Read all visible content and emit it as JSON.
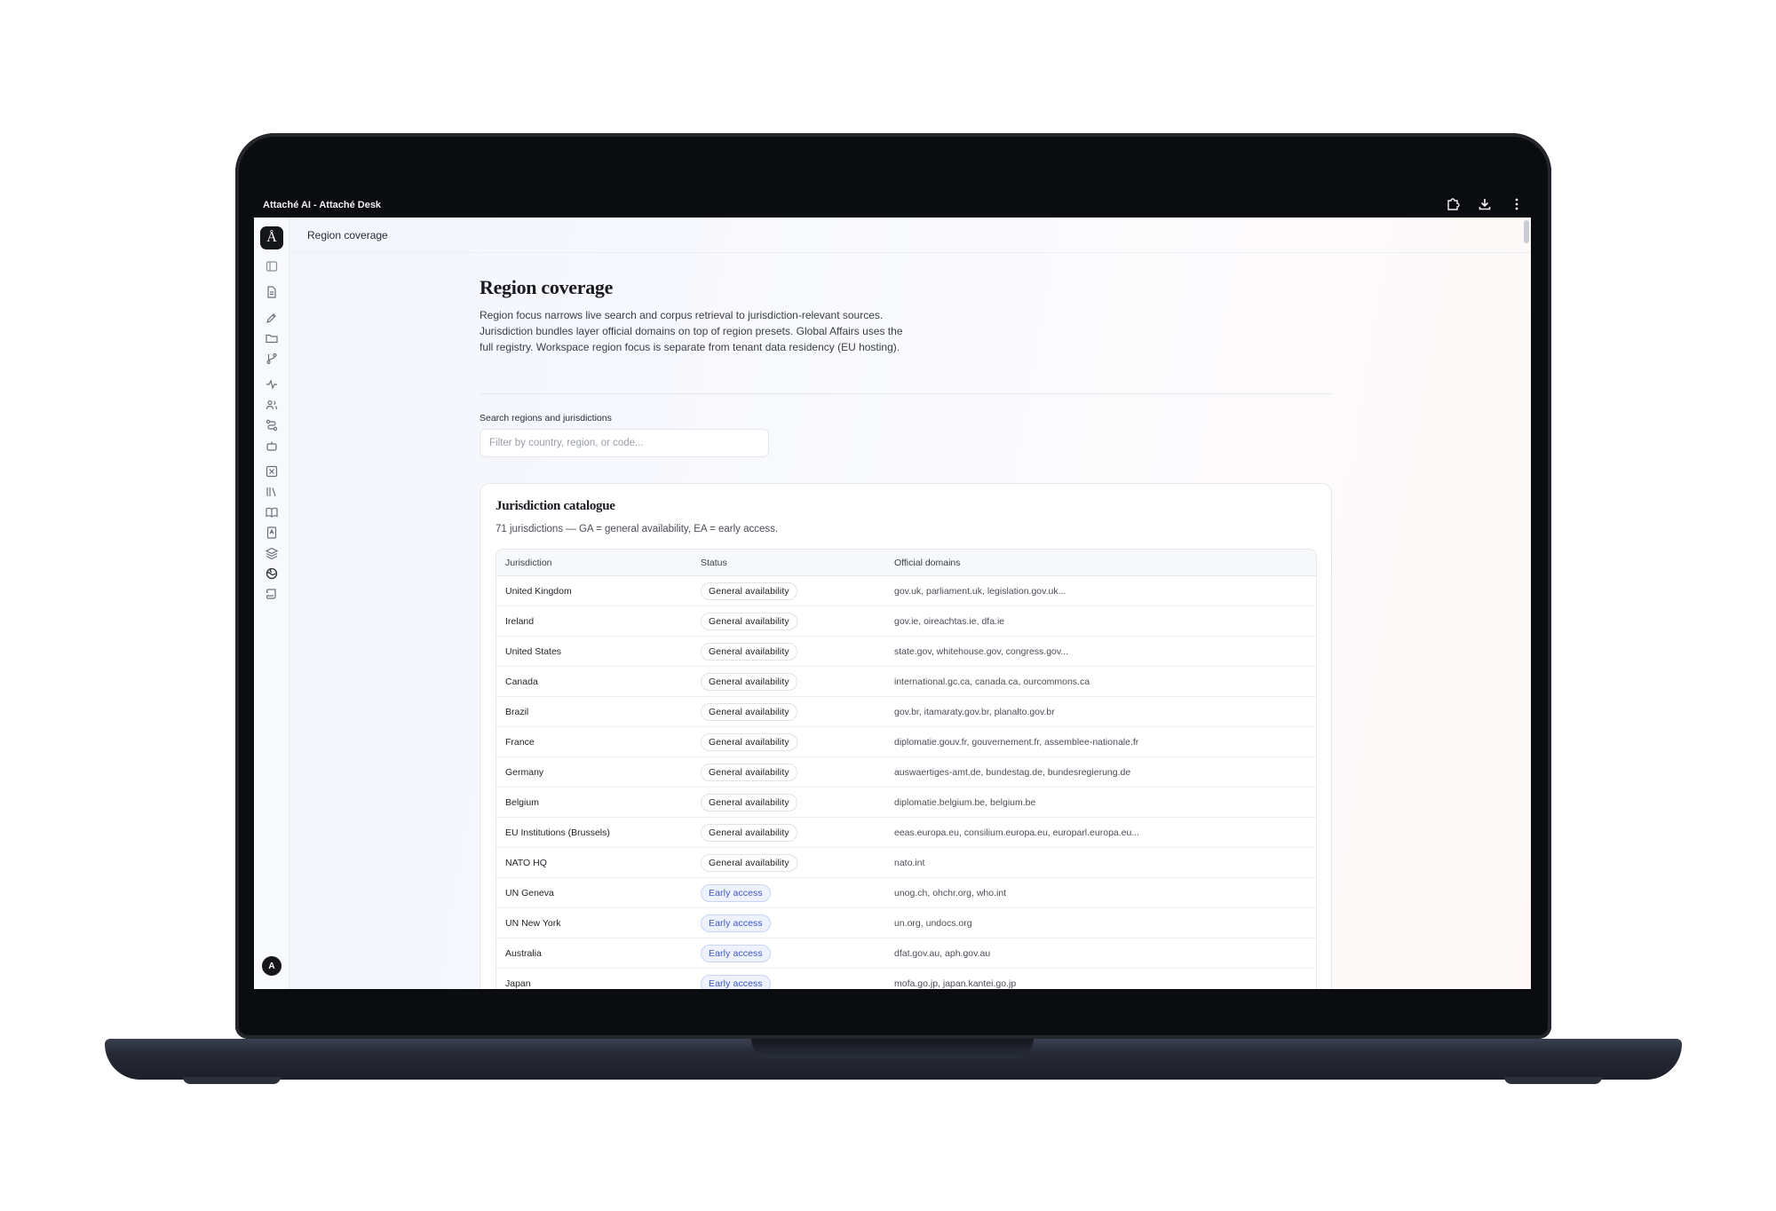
{
  "window": {
    "title": "Attaché AI - Attaché Desk",
    "actions": [
      "extension-icon",
      "download-icon",
      "more-vertical-icon"
    ]
  },
  "rail": {
    "logo": "Å",
    "avatar": "A",
    "icons": [
      "sidebar-toggle-icon",
      "document-icon",
      "pen-icon",
      "folder-icon",
      "git-branch-icon",
      "activity-icon",
      "users-icon",
      "route-icon",
      "bot-icon",
      "square-x-icon",
      "library-icon",
      "book-open-icon",
      "file-text-icon",
      "layers-icon",
      "globe-icon",
      "scroll-icon"
    ]
  },
  "topbar": {
    "breadcrumb": "Region coverage"
  },
  "page": {
    "title": "Region coverage",
    "description": "Region focus narrows live search and corpus retrieval to jurisdiction-relevant sources. Jurisdiction bundles layer official domains on top of region presets. Global Affairs uses the full registry. Workspace region focus is separate from tenant data residency (EU hosting)."
  },
  "search": {
    "label": "Search regions and jurisdictions",
    "placeholder": "Filter by country, region, or code..."
  },
  "catalogue": {
    "title": "Jurisdiction catalogue",
    "subtitle": "71 jurisdictions — GA = general availability, EA = early access.",
    "columns": [
      "Jurisdiction",
      "Status",
      "Official domains"
    ],
    "rows": [
      {
        "jurisdiction": "United Kingdom",
        "status": "General availability",
        "kind": "ga",
        "domains": "gov.uk, parliament.uk, legislation.gov.uk..."
      },
      {
        "jurisdiction": "Ireland",
        "status": "General availability",
        "kind": "ga",
        "domains": "gov.ie, oireachtas.ie, dfa.ie"
      },
      {
        "jurisdiction": "United States",
        "status": "General availability",
        "kind": "ga",
        "domains": "state.gov, whitehouse.gov, congress.gov..."
      },
      {
        "jurisdiction": "Canada",
        "status": "General availability",
        "kind": "ga",
        "domains": "international.gc.ca, canada.ca, ourcommons.ca"
      },
      {
        "jurisdiction": "Brazil",
        "status": "General availability",
        "kind": "ga",
        "domains": "gov.br, itamaraty.gov.br, planalto.gov.br"
      },
      {
        "jurisdiction": "France",
        "status": "General availability",
        "kind": "ga",
        "domains": "diplomatie.gouv.fr, gouvernement.fr, assemblee-nationale.fr"
      },
      {
        "jurisdiction": "Germany",
        "status": "General availability",
        "kind": "ga",
        "domains": "auswaertiges-amt.de, bundestag.de, bundesregierung.de"
      },
      {
        "jurisdiction": "Belgium",
        "status": "General availability",
        "kind": "ga",
        "domains": "diplomatie.belgium.be, belgium.be"
      },
      {
        "jurisdiction": "EU Institutions (Brussels)",
        "status": "General availability",
        "kind": "ga",
        "domains": "eeas.europa.eu, consilium.europa.eu, europarl.europa.eu..."
      },
      {
        "jurisdiction": "NATO HQ",
        "status": "General availability",
        "kind": "ga",
        "domains": "nato.int"
      },
      {
        "jurisdiction": "UN Geneva",
        "status": "Early access",
        "kind": "ea",
        "domains": "unog.ch, ohchr.org, who.int"
      },
      {
        "jurisdiction": "UN New York",
        "status": "Early access",
        "kind": "ea",
        "domains": "un.org, undocs.org"
      },
      {
        "jurisdiction": "Australia",
        "status": "Early access",
        "kind": "ea",
        "domains": "dfat.gov.au, aph.gov.au"
      },
      {
        "jurisdiction": "Japan",
        "status": "Early access",
        "kind": "ea",
        "domains": "mofa.go.jp, japan.kantei.go.jp"
      }
    ]
  },
  "colors": {
    "accent": "#3a57c6",
    "early_access_bg": "#eef2fd",
    "rail_logo": "#15161a"
  }
}
